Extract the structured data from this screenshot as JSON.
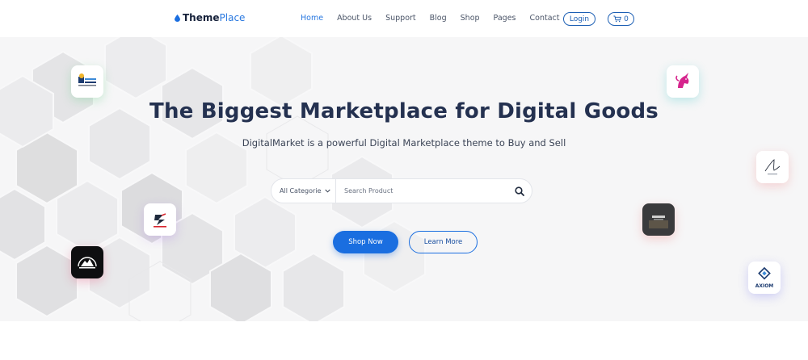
{
  "header": {
    "logo": {
      "part1": "Theme",
      "part2": "Place",
      "icon": "drop-icon",
      "accent_color": "#2a79e0"
    },
    "nav": [
      {
        "label": "Home",
        "active": true
      },
      {
        "label": "About Us",
        "active": false
      },
      {
        "label": "Support",
        "active": false
      },
      {
        "label": "Blog",
        "active": false
      },
      {
        "label": "Shop",
        "active": false
      },
      {
        "label": "Pages",
        "active": false
      },
      {
        "label": "Contact",
        "active": false
      }
    ],
    "login_label": "Login",
    "cart": {
      "icon": "cart-icon",
      "count": "0"
    }
  },
  "hero": {
    "title": "The Biggest Marketplace for Digital Goods",
    "subtitle": "DigitalMarket is a powerful Digital Marketplace theme to Buy and Sell",
    "search": {
      "category_value": "All Categories",
      "placeholder": "Search Product",
      "icon": "search-icon"
    },
    "primary_button": "Shop Now",
    "secondary_button": "Learn More",
    "badges": {
      "axiom": "AXIOM"
    }
  },
  "colors": {
    "primary": "#1a6ee0",
    "title": "#243150",
    "hero_bg": "#f6f6f7"
  }
}
